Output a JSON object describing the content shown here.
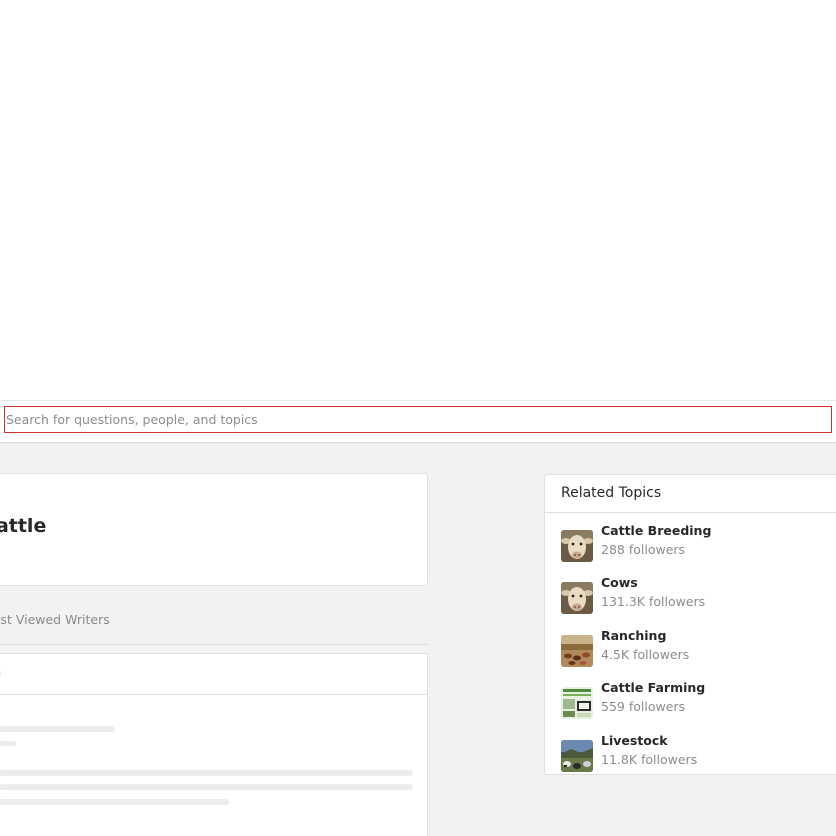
{
  "search": {
    "placeholder": "Search for questions, people, and topics"
  },
  "topic": {
    "title": "Cattle",
    "tab_label": "Most Viewed Writers"
  },
  "related_topics": {
    "heading": "Related Topics",
    "items": [
      {
        "name": "Cattle Breeding",
        "followers": "288 followers",
        "icon": "cow-face-thumbnail"
      },
      {
        "name": "Cows",
        "followers": "131.3K followers",
        "icon": "cow-face-thumbnail"
      },
      {
        "name": "Ranching",
        "followers": "4.5K followers",
        "icon": "herd-field-thumbnail"
      },
      {
        "name": "Cattle Farming",
        "followers": "559 followers",
        "icon": "farm-poster-thumbnail"
      },
      {
        "name": "Livestock",
        "followers": "11.8K followers",
        "icon": "pasture-herd-thumbnail"
      }
    ]
  },
  "colors": {
    "search_focus_border": "#d32f2f",
    "page_background": "#f1f2f2",
    "card_border": "#dee0e1",
    "muted_text": "#8c8c8c"
  }
}
